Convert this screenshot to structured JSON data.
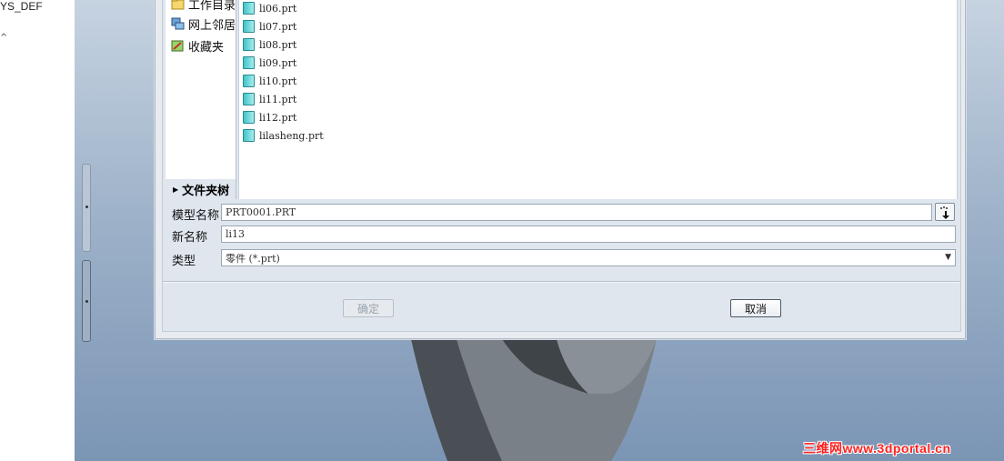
{
  "model_tree": {
    "partial_item": "YS_DEF",
    "caret": "^"
  },
  "dialog": {
    "places": [
      {
        "label": "工作目录",
        "icon": "folder-icon"
      },
      {
        "label": "网上邻居",
        "icon": "network-icon"
      },
      {
        "label": "收藏夹",
        "icon": "favorites-icon"
      }
    ],
    "folder_tree_label": "文件夹树",
    "files": [
      "li06.prt",
      "li07.prt",
      "li08.prt",
      "li09.prt",
      "li10.prt",
      "li11.prt",
      "li12.prt",
      "lilasheng.prt"
    ],
    "form": {
      "model_name_label": "模型名称",
      "model_name_value": "PRT0001.PRT",
      "new_name_label": "新名称",
      "new_name_value": "li13",
      "type_label": "类型",
      "type_value": "零件 (*.prt)"
    },
    "buttons": {
      "ok": "确定",
      "cancel": "取消"
    }
  },
  "watermark": "三维网www.3dportal.cn",
  "colors": {
    "file_icon": "#3fc3c8",
    "watermark": "#ff2020",
    "model_dark": "#4a4f55",
    "model_light": "#7a8087"
  }
}
